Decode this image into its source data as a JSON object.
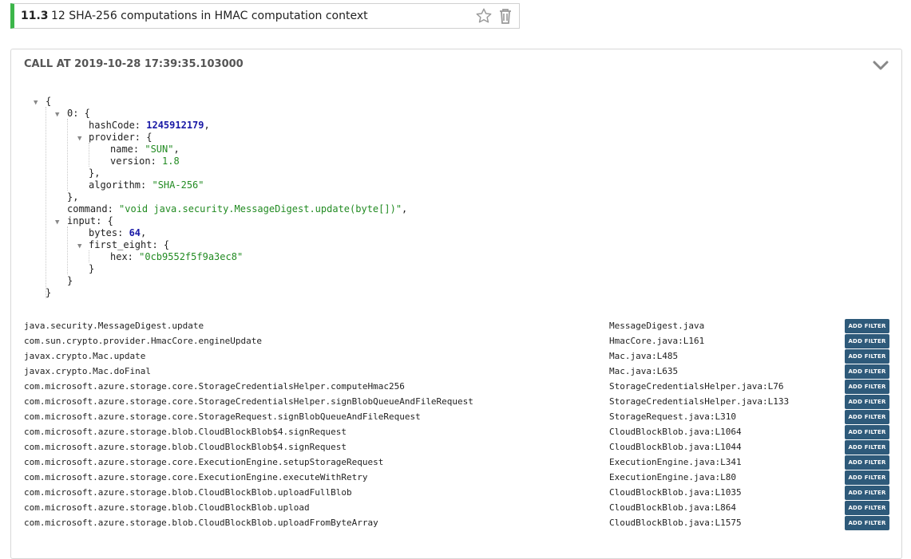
{
  "section": {
    "number": "11.3",
    "title": "12 SHA-256 computations in HMAC computation context"
  },
  "call": {
    "title": "CALL AT 2019-10-28 17:39:35.103000"
  },
  "json": {
    "open_brace": "{",
    "item_key": "0: {",
    "hashCode_key": "hashCode: ",
    "hashCode_val": "1245912179",
    "comma": ",",
    "provider_key": "provider: {",
    "name_key": "name: ",
    "name_val": "\"SUN\"",
    "version_key": "version: ",
    "version_val": "1.8",
    "close_brace_comma": "},",
    "algorithm_key": "algorithm: ",
    "algorithm_val": "\"SHA-256\"",
    "command_key": "command: ",
    "command_val": "\"void java.security.MessageDigest.update(byte[])\"",
    "input_key": "input: {",
    "bytes_key": "bytes: ",
    "bytes_val": "64",
    "first_eight_key": "first_eight: {",
    "hex_key": "hex: ",
    "hex_val": "\"0cb9552f5f9a3ec8\"",
    "close_brace": "}"
  },
  "stack": {
    "button_label": "ADD FILTER",
    "rows": [
      {
        "method": "java.security.MessageDigest.update",
        "location": "MessageDigest.java"
      },
      {
        "method": "com.sun.crypto.provider.HmacCore.engineUpdate",
        "location": "HmacCore.java:L161"
      },
      {
        "method": "javax.crypto.Mac.update",
        "location": "Mac.java:L485"
      },
      {
        "method": "javax.crypto.Mac.doFinal",
        "location": "Mac.java:L635"
      },
      {
        "method": "com.microsoft.azure.storage.core.StorageCredentialsHelper.computeHmac256",
        "location": "StorageCredentialsHelper.java:L76"
      },
      {
        "method": "com.microsoft.azure.storage.core.StorageCredentialsHelper.signBlobQueueAndFileRequest",
        "location": "StorageCredentialsHelper.java:L133"
      },
      {
        "method": "com.microsoft.azure.storage.core.StorageRequest.signBlobQueueAndFileRequest",
        "location": "StorageRequest.java:L310"
      },
      {
        "method": "com.microsoft.azure.storage.blob.CloudBlockBlob$4.signRequest",
        "location": "CloudBlockBlob.java:L1064"
      },
      {
        "method": "com.microsoft.azure.storage.blob.CloudBlockBlob$4.signRequest",
        "location": "CloudBlockBlob.java:L1044"
      },
      {
        "method": "com.microsoft.azure.storage.core.ExecutionEngine.setupStorageRequest",
        "location": "ExecutionEngine.java:L341"
      },
      {
        "method": "com.microsoft.azure.storage.core.ExecutionEngine.executeWithRetry",
        "location": "ExecutionEngine.java:L80"
      },
      {
        "method": "com.microsoft.azure.storage.blob.CloudBlockBlob.uploadFullBlob",
        "location": "CloudBlockBlob.java:L1035"
      },
      {
        "method": "com.microsoft.azure.storage.blob.CloudBlockBlob.upload",
        "location": "CloudBlockBlob.java:L864"
      },
      {
        "method": "com.microsoft.azure.storage.blob.CloudBlockBlob.uploadFromByteArray",
        "location": "CloudBlockBlob.java:L1575"
      }
    ]
  }
}
